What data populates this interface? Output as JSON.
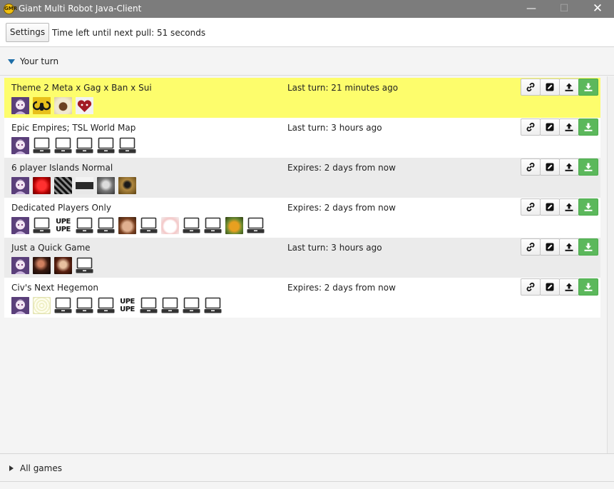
{
  "window": {
    "title": "Giant Multi Robot Java-Client",
    "icon_text": "GMR",
    "minimize_glyph": "—",
    "maximize_glyph": "☐",
    "close_glyph": "✕"
  },
  "toolbar": {
    "settings_label": "Settings",
    "timer_text": "Time left until next pull: 51 seconds"
  },
  "sections": {
    "your_turn_label": "Your turn",
    "all_games_label": "All games"
  },
  "colors": {
    "highlight_row": "#fdfd6c",
    "download_button": "#5cb85c",
    "expand_arrow": "#1e6ea8"
  },
  "action_icons": [
    "link-icon",
    "edit-icon",
    "upload-icon",
    "download-icon"
  ],
  "games": [
    {
      "name": "Theme 2 Meta x Gag x Ban x Sui",
      "status": "Last turn: 21 minutes ago",
      "highlighted": true,
      "players": [
        "purple",
        "ram",
        "coffee",
        "heart"
      ]
    },
    {
      "name": "Epic Empires; TSL World Map",
      "status": "Last turn: 3 hours ago",
      "highlighted": false,
      "players": [
        "purple",
        "laptop",
        "laptop",
        "laptop",
        "laptop",
        "laptop"
      ]
    },
    {
      "name": "6 player Islands Normal",
      "status": "Expires: 2 days from now",
      "highlighted": false,
      "players": [
        "purple",
        "red",
        "bw",
        "mug",
        "gray",
        "brown"
      ]
    },
    {
      "name": "Dedicated Players Only",
      "status": "Expires: 2 days from now",
      "highlighted": false,
      "players": [
        "purple",
        "laptop",
        "upe",
        "laptop",
        "laptop",
        "face",
        "laptop",
        "cat",
        "laptop",
        "laptop",
        "food",
        "laptop"
      ]
    },
    {
      "name": "Just a Quick Game",
      "status": "Last turn: 3 hours ago",
      "highlighted": false,
      "players": [
        "purple",
        "dark",
        "girl",
        "laptop"
      ]
    },
    {
      "name": "Civ's Next Hegemon",
      "status": "Expires: 2 days from now",
      "highlighted": false,
      "players": [
        "purple",
        "light",
        "laptop",
        "laptop",
        "laptop",
        "upe",
        "laptop",
        "laptop",
        "laptop",
        "laptop"
      ]
    }
  ],
  "upe_avatar_text": [
    "UPE",
    "UPE"
  ]
}
